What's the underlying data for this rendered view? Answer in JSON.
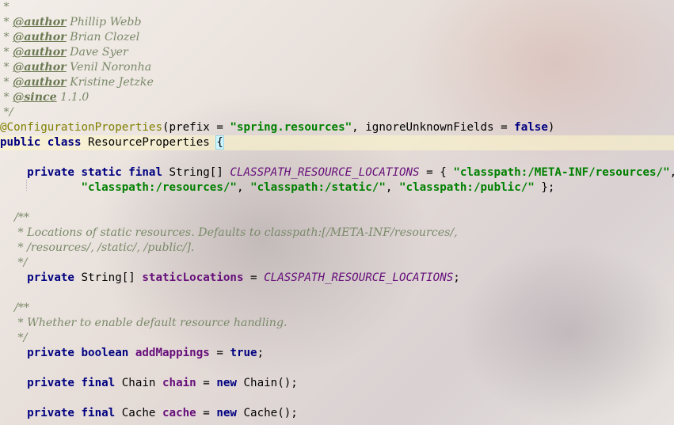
{
  "code": {
    "l1": {
      "star": " *"
    },
    "l2": {
      "prefix": " * ",
      "tag": "@author",
      "text": " Phillip Webb"
    },
    "l3": {
      "prefix": " * ",
      "tag": "@author",
      "text": " Brian Clozel"
    },
    "l4": {
      "prefix": " * ",
      "tag": "@author",
      "text": " Dave Syer"
    },
    "l5": {
      "prefix": " * ",
      "tag": "@author",
      "text": " Venil Noronha"
    },
    "l6": {
      "prefix": " * ",
      "tag": "@author",
      "text": " Kristine Jetzke"
    },
    "l7": {
      "prefix": " * ",
      "tag": "@since",
      "text": " 1.1.0"
    },
    "l8": {
      "end": " */"
    },
    "l9": {
      "annotation": "@ConfigurationProperties",
      "p1": "(prefix = ",
      "str": "\"spring.resources\"",
      "p2": ", ignoreUnknownFields = ",
      "kw": "false",
      "p3": ")"
    },
    "l10": {
      "kw": "public class ",
      "name": "ResourceProperties ",
      "brace": "{"
    },
    "l11": {
      "kw": "    private static final ",
      "type": "String[] ",
      "const": "CLASSPATH_RESOURCE_LOCATIONS",
      "eq": " = { ",
      "s1": "\"classpath:/META-INF/resources/\"",
      "comma": ","
    },
    "l12": {
      "indent": "            ",
      "s1": "\"classpath:/resources/\"",
      "c1": ", ",
      "s2": "\"classpath:/static/\"",
      "c2": ", ",
      "s3": "\"classpath:/public/\"",
      "end": " };"
    },
    "l13": {
      "text": "    /**"
    },
    "l14": {
      "text": "     * Locations of static resources. Defaults to classpath:[/META-INF/resources/,"
    },
    "l15": {
      "text": "     * /resources/, /static/, /public/]."
    },
    "l16": {
      "text": "     */"
    },
    "l17": {
      "kw": "    private ",
      "type": "String[] ",
      "field": "staticLocations",
      "eq": " = ",
      "const": "CLASSPATH_RESOURCE_LOCATIONS",
      "semi": ";"
    },
    "l18": {
      "text": "    /**"
    },
    "l19": {
      "text": "     * Whether to enable default resource handling."
    },
    "l20": {
      "text": "     */"
    },
    "l21": {
      "kw": "    private boolean ",
      "field": "addMappings",
      "eq": " = ",
      "val": "true",
      "semi": ";"
    },
    "l22": {
      "kw": "    private final ",
      "type": "Chain ",
      "field": "chain",
      "eq": " = ",
      "new": "new ",
      "ctor": "Chain();"
    },
    "l23": {
      "kw": "    private final ",
      "type": "Cache ",
      "field": "cache",
      "eq": " = ",
      "new": "new ",
      "ctor": "Cache();"
    }
  }
}
